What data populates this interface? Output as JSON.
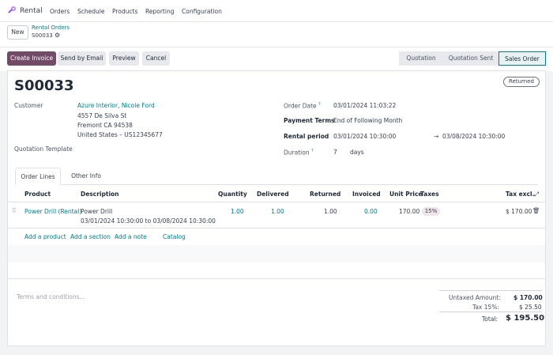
{
  "nav": {
    "app_name": "Rental",
    "menu": [
      "Orders",
      "Schedule",
      "Products",
      "Reporting",
      "Configuration"
    ]
  },
  "control": {
    "new_label": "New",
    "breadcrumb_parent": "Rental Orders",
    "breadcrumb_current": "S00033"
  },
  "actions": {
    "create_invoice": "Create Invoice",
    "send_email": "Send by Email",
    "preview": "Preview",
    "cancel": "Cancel"
  },
  "statusbar": {
    "steps": [
      "Quotation",
      "Quotation Sent",
      "Sales Order"
    ],
    "active": "Sales Order"
  },
  "form": {
    "order_name": "S00033",
    "ribbon": "Returned",
    "customer_label": "Customer",
    "customer_name": "Azure Interior, Nicole Ford",
    "customer_address": [
      "4557 De Silva St",
      "Fremont CA 94538",
      "United States – US12345677"
    ],
    "quotation_template_label": "Quotation Template",
    "order_date_label": "Order Date",
    "order_date": "03/01/2024 11:03:22",
    "payment_terms_label": "Payment Terms",
    "payment_terms": "End of Following Month",
    "rental_period_label": "Rental period",
    "rental_start": "03/01/2024 10:30:00",
    "rental_end": "03/08/2024 10:30:00",
    "duration_label": "Duration",
    "duration_value": "7",
    "duration_unit": "days"
  },
  "tabs": [
    "Order Lines",
    "Other Info"
  ],
  "table": {
    "headers": [
      "Product",
      "Description",
      "Quantity",
      "Delivered",
      "Returned",
      "Invoiced",
      "Unit Price",
      "Taxes",
      "Tax excl."
    ],
    "rows": [
      {
        "product": "Power Drill (Rental)",
        "description": "Power Drill",
        "description_line2": "03/01/2024 10:30:00 to 03/08/2024 10:30:00",
        "quantity": "1.00",
        "delivered": "1.00",
        "returned": "1.00",
        "invoiced": "0.00",
        "unit_price": "170.00",
        "taxes": "15%",
        "subtotal": "$ 170.00"
      }
    ],
    "add_product": "Add a product",
    "add_section": "Add a section",
    "add_note": "Add a note",
    "catalog": "Catalog"
  },
  "terms_placeholder": "Terms and conditions...",
  "totals": {
    "untaxed_label": "Untaxed Amount:",
    "untaxed_value": "$ 170.00",
    "tax_label": "Tax 15%:",
    "tax_value": "$ 25.50",
    "total_label": "Total:",
    "total_value": "$ 195.50"
  },
  "colors": {
    "primary": "#714b67",
    "link": "#017e84"
  }
}
